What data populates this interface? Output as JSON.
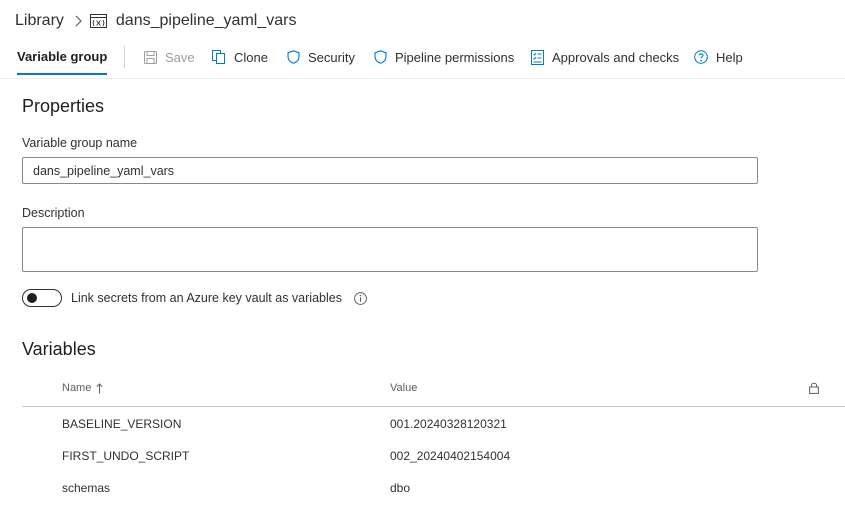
{
  "breadcrumb": {
    "library": "Library",
    "group": "dans_pipeline_yaml_vars"
  },
  "toolbar": {
    "active_tab": "Variable group",
    "save": "Save",
    "clone": "Clone",
    "security": "Security",
    "pipeline_permissions": "Pipeline permissions",
    "approvals": "Approvals and checks",
    "help": "Help"
  },
  "properties": {
    "title": "Properties",
    "name_label": "Variable group name",
    "name_value": "dans_pipeline_yaml_vars",
    "description_label": "Description",
    "description_value": "",
    "keyvault_label": "Link secrets from an Azure key vault as variables",
    "keyvault_enabled": false
  },
  "variables": {
    "title": "Variables",
    "columns": {
      "name": "Name",
      "value": "Value"
    },
    "sort": "ascending",
    "rows": [
      {
        "name": "BASELINE_VERSION",
        "value": "001.20240328120321"
      },
      {
        "name": "FIRST_UNDO_SCRIPT",
        "value": "002_20240402154004"
      },
      {
        "name": "schemas",
        "value": "dbo"
      }
    ]
  },
  "colors": {
    "accent": "#0078d4",
    "text": "#323130",
    "disabled": "#a19f9d"
  }
}
